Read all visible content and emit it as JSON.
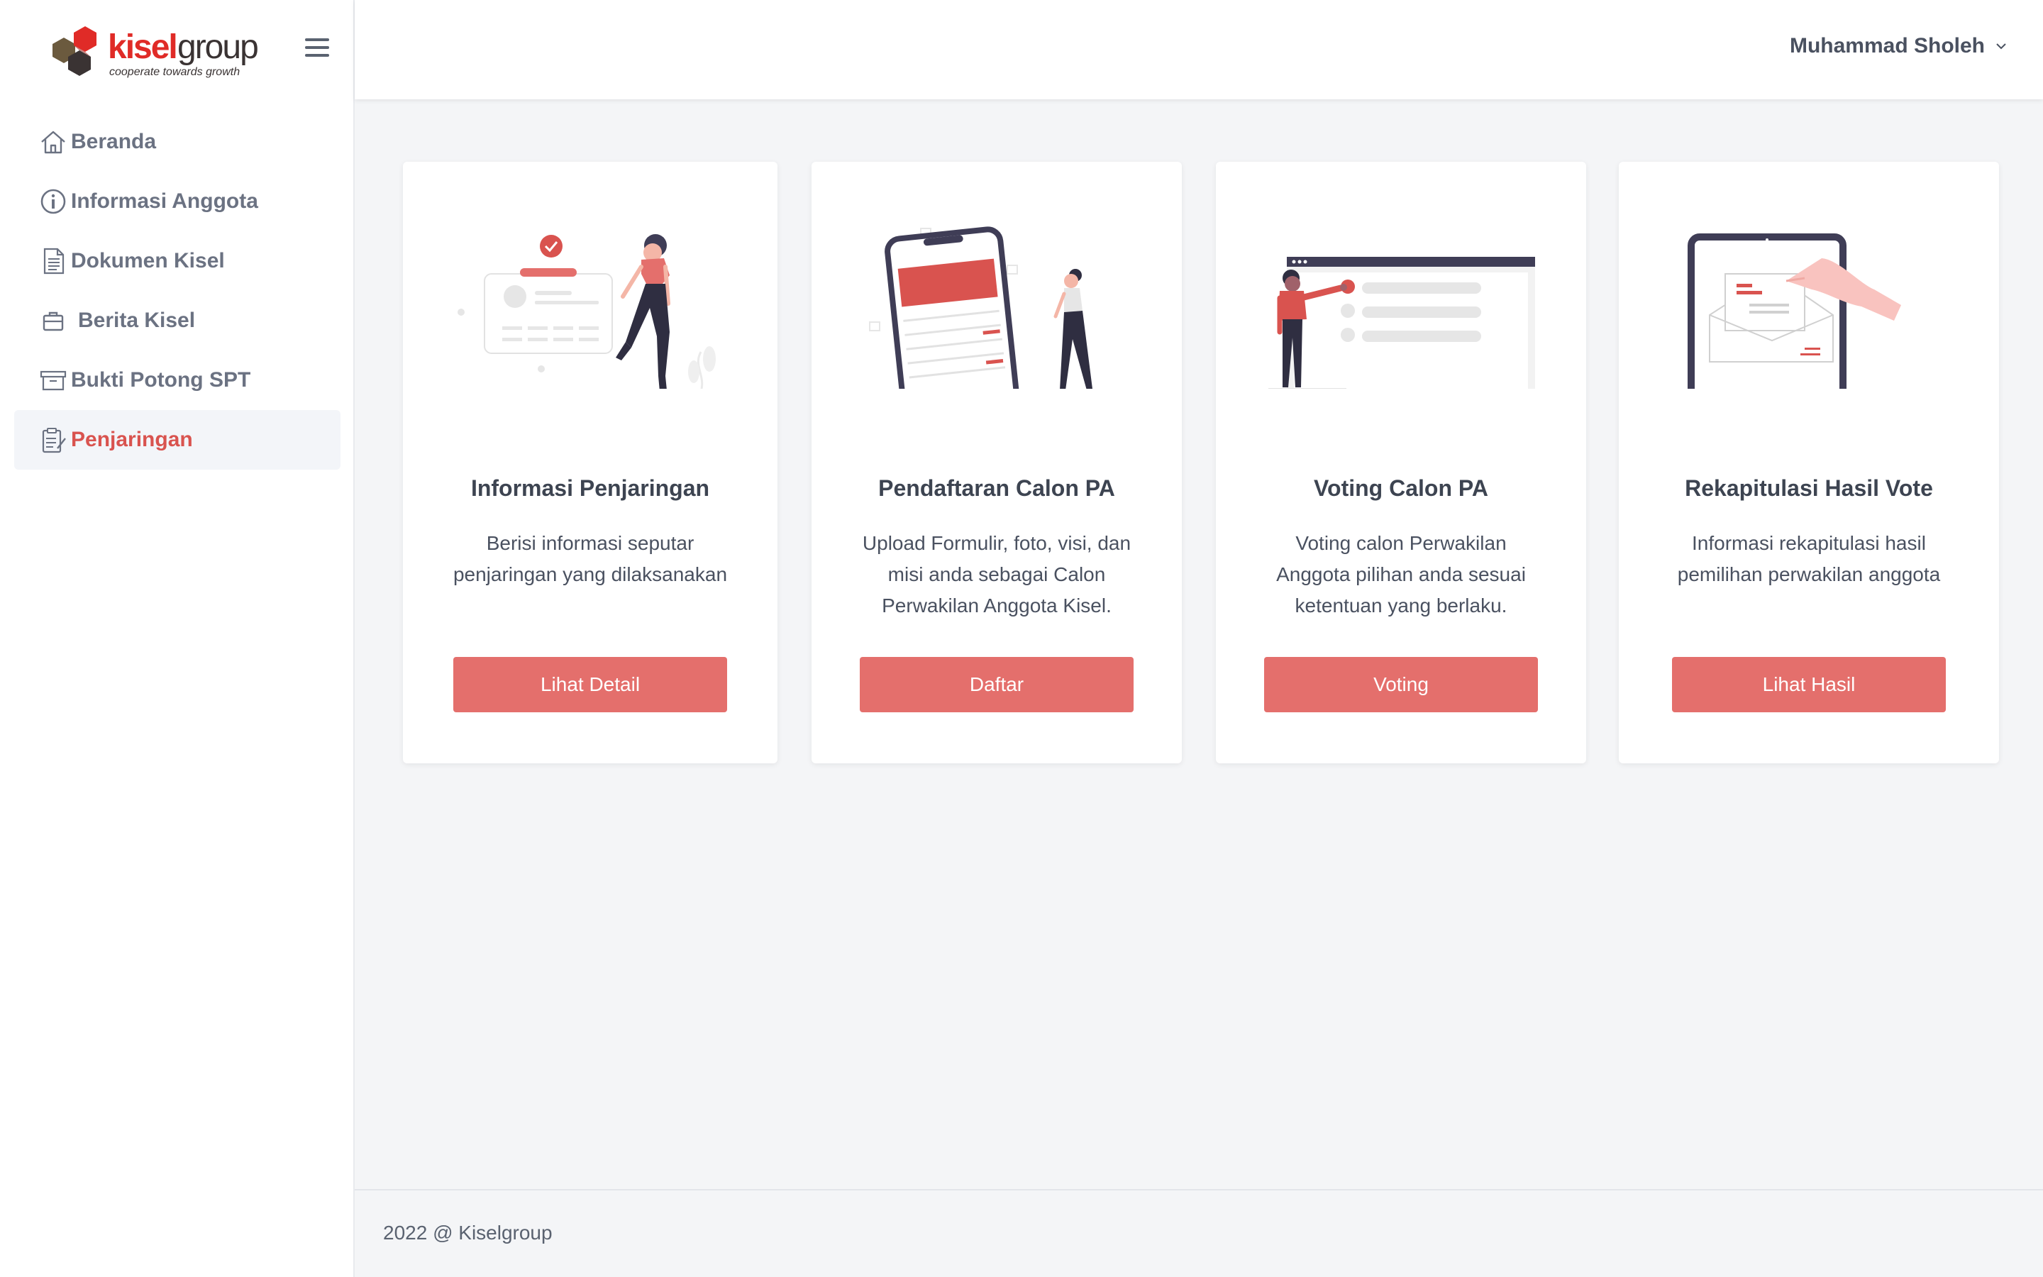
{
  "brand": {
    "name_red": "kisel",
    "name_dark": "group",
    "tagline": "cooperate towards growth"
  },
  "header": {
    "user_name": "Muhammad Sholeh",
    "user_menu_icon": "chevron-down-icon"
  },
  "sidebar": {
    "items": [
      {
        "label": "Beranda",
        "icon": "home-icon"
      },
      {
        "label": "Informasi Anggota",
        "icon": "info-icon"
      },
      {
        "label": "Dokumen Kisel",
        "icon": "document-icon"
      },
      {
        "label": "Berita Kisel",
        "icon": "briefcase-icon"
      },
      {
        "label": "Bukti Potong SPT",
        "icon": "archive-icon"
      },
      {
        "label": "Penjaringan",
        "icon": "clipboard-icon",
        "active": true
      }
    ]
  },
  "cards": [
    {
      "title": "Informasi Penjaringan",
      "description": "Berisi informasi seputar penjaringan yang dilaksanakan",
      "button": "Lihat Detail"
    },
    {
      "title": "Pendaftaran Calon PA",
      "description": "Upload Formulir, foto, visi, dan misi anda sebagai Calon Perwakilan Anggota Kisel.",
      "button": "Daftar"
    },
    {
      "title": "Voting Calon PA",
      "description": "Voting calon Perwakilan Anggota pilihan anda sesuai ketentuan yang berlaku.",
      "button": "Voting"
    },
    {
      "title": "Rekapitulasi Hasil Vote",
      "description": "Informasi rekapitulasi hasil pemilihan perwakilan anggota",
      "button": "Lihat Hasil"
    }
  ],
  "footer": {
    "text": "2022 @ Kiselgroup"
  },
  "colors": {
    "accent": "#e46f6c",
    "active_text": "#d9534f",
    "brand_red": "#e02b27",
    "brand_dark": "#3a3333"
  }
}
